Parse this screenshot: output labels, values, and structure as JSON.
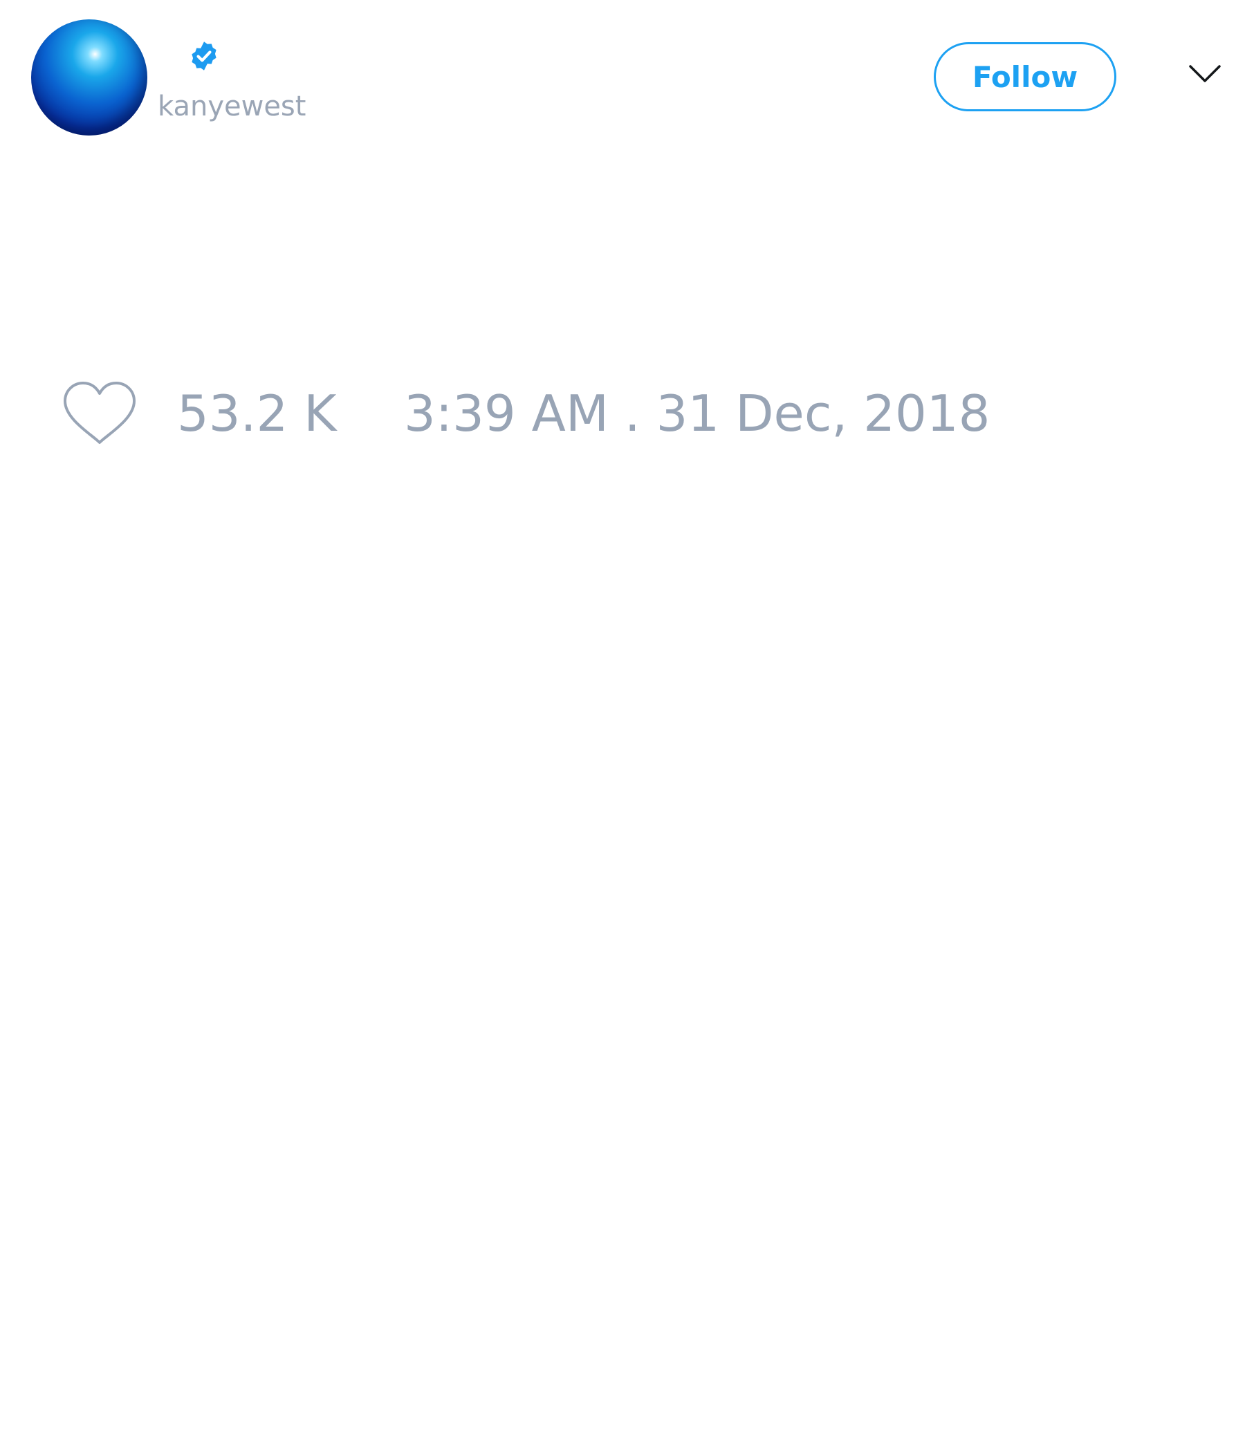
{
  "profile": {
    "username": "kanyewest",
    "verified": true,
    "avatar_icon": "blue-orb-avatar"
  },
  "header": {
    "follow_label": "Follow",
    "menu_icon": "chevron-down-icon"
  },
  "stats": {
    "like_icon": "heart-outline-icon",
    "likes": "53.2 K",
    "timestamp": "3:39 AM . 31 Dec, 2018"
  },
  "colors": {
    "accent": "#1da1f2",
    "muted_text": "#98a4b5",
    "background": "#ffffff"
  }
}
